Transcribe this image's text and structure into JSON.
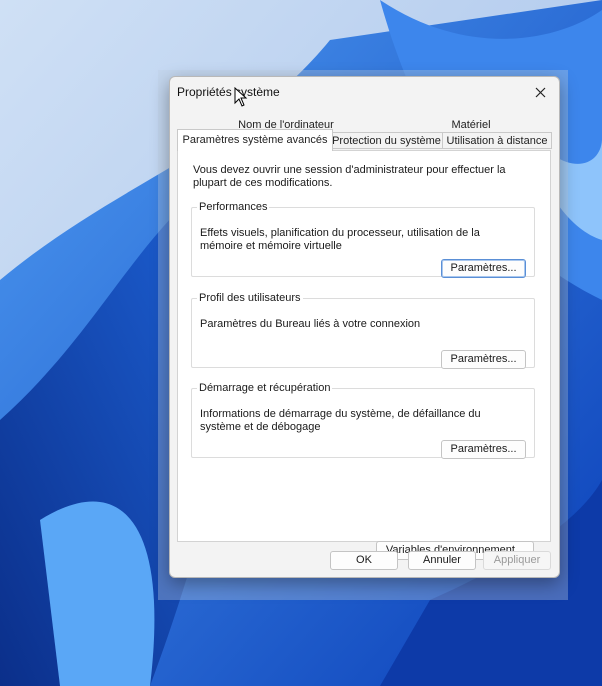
{
  "dialog": {
    "title": "Propriétés système",
    "close_icon": "close-icon"
  },
  "tabs": {
    "back_row": [
      "Nom de l'ordinateur",
      "Matériel"
    ],
    "front_row": [
      "Paramètres système avancés",
      "Protection du système",
      "Utilisation à distance"
    ],
    "active": "Paramètres système avancés"
  },
  "panel": {
    "admin_note": "Vous devez ouvrir une session d'administrateur pour effectuer la plupart de ces modifications.",
    "performance": {
      "legend": "Performances",
      "description": "Effets visuels, planification du processeur, utilisation de la mémoire et mémoire virtuelle",
      "button": "Paramètres..."
    },
    "profiles": {
      "legend": "Profil des utilisateurs",
      "description": "Paramètres du Bureau liés à votre connexion",
      "button": "Paramètres..."
    },
    "startup": {
      "legend": "Démarrage et récupération",
      "description": "Informations de démarrage du système, de défaillance du système et de débogage",
      "button": "Paramètres..."
    },
    "env_button": "Variables d'environnement..."
  },
  "footer": {
    "ok": "OK",
    "cancel": "Annuler",
    "apply": "Appliquer"
  },
  "colors": {
    "wallpaper_base": "#2f6fe0",
    "dialog_bg": "#f3f3f3",
    "primary_border": "#5a8fd6"
  }
}
